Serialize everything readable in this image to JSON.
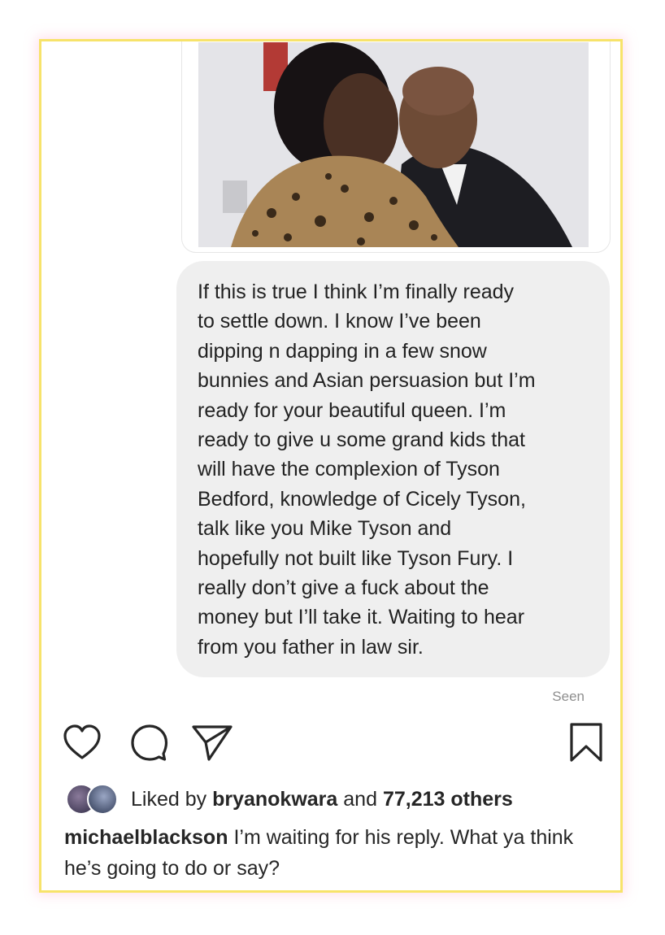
{
  "message": {
    "text": "If this is true I think I’m finally ready\nto settle down. I know I’ve been\ndipping n dapping in a few snow\nbunnies and Asian persuasion but I’m\nready for your beautiful queen. I’m\nready to give u some grand kids that\nwill have the complexion of Tyson\nBedford, knowledge of Cicely Tyson,\ntalk like you Mike Tyson and\nhopefully not built like Tyson Fury. I\nreally don’t give a fuck about the\nmoney but I’ll take it. Waiting to hear\nfrom you father in law sir.",
    "status": "Seen"
  },
  "post": {
    "likes_prefix": "Liked by",
    "liked_by_user": "bryanokwara",
    "likes_connector": "and",
    "likes_others": "77,213 others",
    "caption_user": "michaelblackson",
    "caption_text": "I’m waiting for his reply. What ya think he’s going to do or say?"
  },
  "icons": {
    "like": "heart-icon",
    "comment": "comment-icon",
    "share": "paper-plane-icon",
    "save": "bookmark-icon"
  },
  "colors": {
    "frame_border": "#f7e36a",
    "bubble_bg": "#efefef",
    "seen_text": "#8e8e8e",
    "text": "#262626"
  }
}
